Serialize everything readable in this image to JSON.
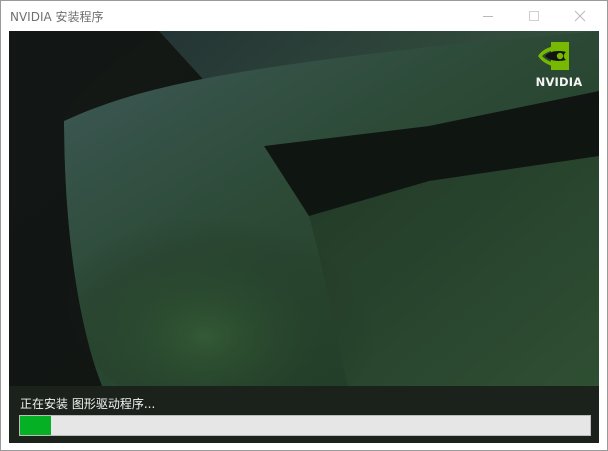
{
  "window": {
    "title": "NVIDIA 安装程序"
  },
  "brand": {
    "logo_icon": "nvidia-eye-icon",
    "logo_text": "NVIDIA",
    "accent_color": "#76b900"
  },
  "installer": {
    "status_text": "正在安装 图形驱动程序...",
    "progress_fraction": 0.055,
    "progress_color": "#06b025"
  },
  "window_controls": {
    "minimize_icon": "minimize-icon",
    "maximize_icon": "maximize-icon",
    "close_icon": "close-icon"
  }
}
